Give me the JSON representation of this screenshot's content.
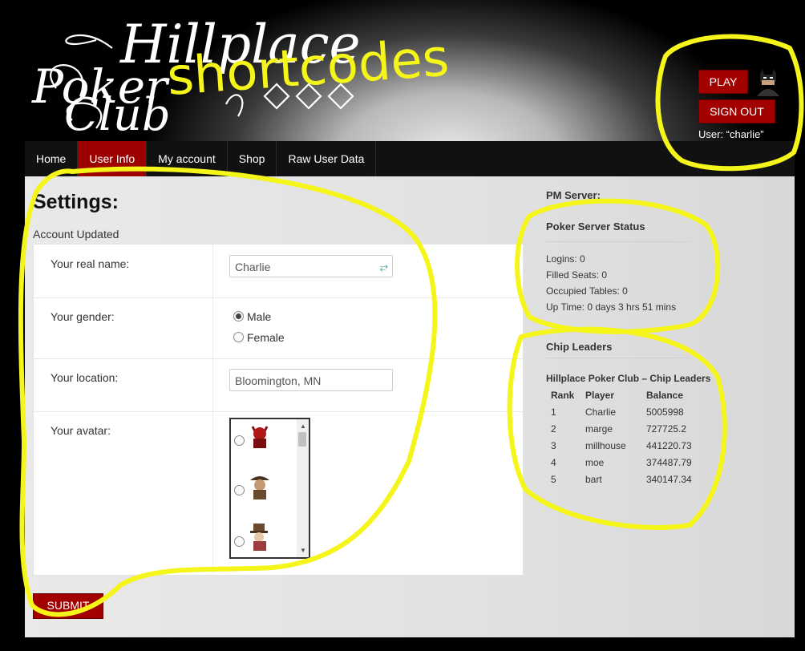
{
  "header": {
    "logo_text": "Hillplace Poker Club",
    "scribble_text": "shortcodes",
    "play_label": "PLAY",
    "signout_label": "SIGN OUT",
    "user_line": "User: “charlie”"
  },
  "nav": {
    "items": [
      "Home",
      "User Info",
      "My account",
      "Shop",
      "Raw User Data"
    ],
    "active": "User Info"
  },
  "main": {
    "title": "Settings:",
    "status": "Account Updated",
    "fields": {
      "name_label": "Your real name:",
      "name_value": "Charlie",
      "gender_label": "Your gender:",
      "gender_options": [
        "Male",
        "Female"
      ],
      "gender_selected": "Male",
      "location_label": "Your location:",
      "location_value": "Bloomington, MN",
      "avatar_label": "Your avatar:"
    },
    "submit_label": "SUBMIT"
  },
  "sidebar": {
    "pm_server_label": "PM Server:",
    "status_title": "Poker Server Status",
    "logins": "Logins: 0",
    "filled_seats": "Filled Seats: 0",
    "occupied_tables": "Occupied Tables: 0",
    "uptime": "Up Time: 0 days 3 hrs 51 mins",
    "chip_title": "Chip Leaders",
    "leaderboard_title": "Hillplace Poker Club – Chip Leaders",
    "columns": [
      "Rank",
      "Player",
      "Balance"
    ],
    "rows": [
      [
        "1",
        "Charlie",
        "5005998"
      ],
      [
        "2",
        "marge",
        "727725.2"
      ],
      [
        "3",
        "millhouse",
        "441220.73"
      ],
      [
        "4",
        "moe",
        "374487.79"
      ],
      [
        "5",
        "bart",
        "340147.34"
      ]
    ]
  },
  "colors": {
    "accent_red": "#a30000",
    "highlight_yellow": "#f5f51a"
  }
}
